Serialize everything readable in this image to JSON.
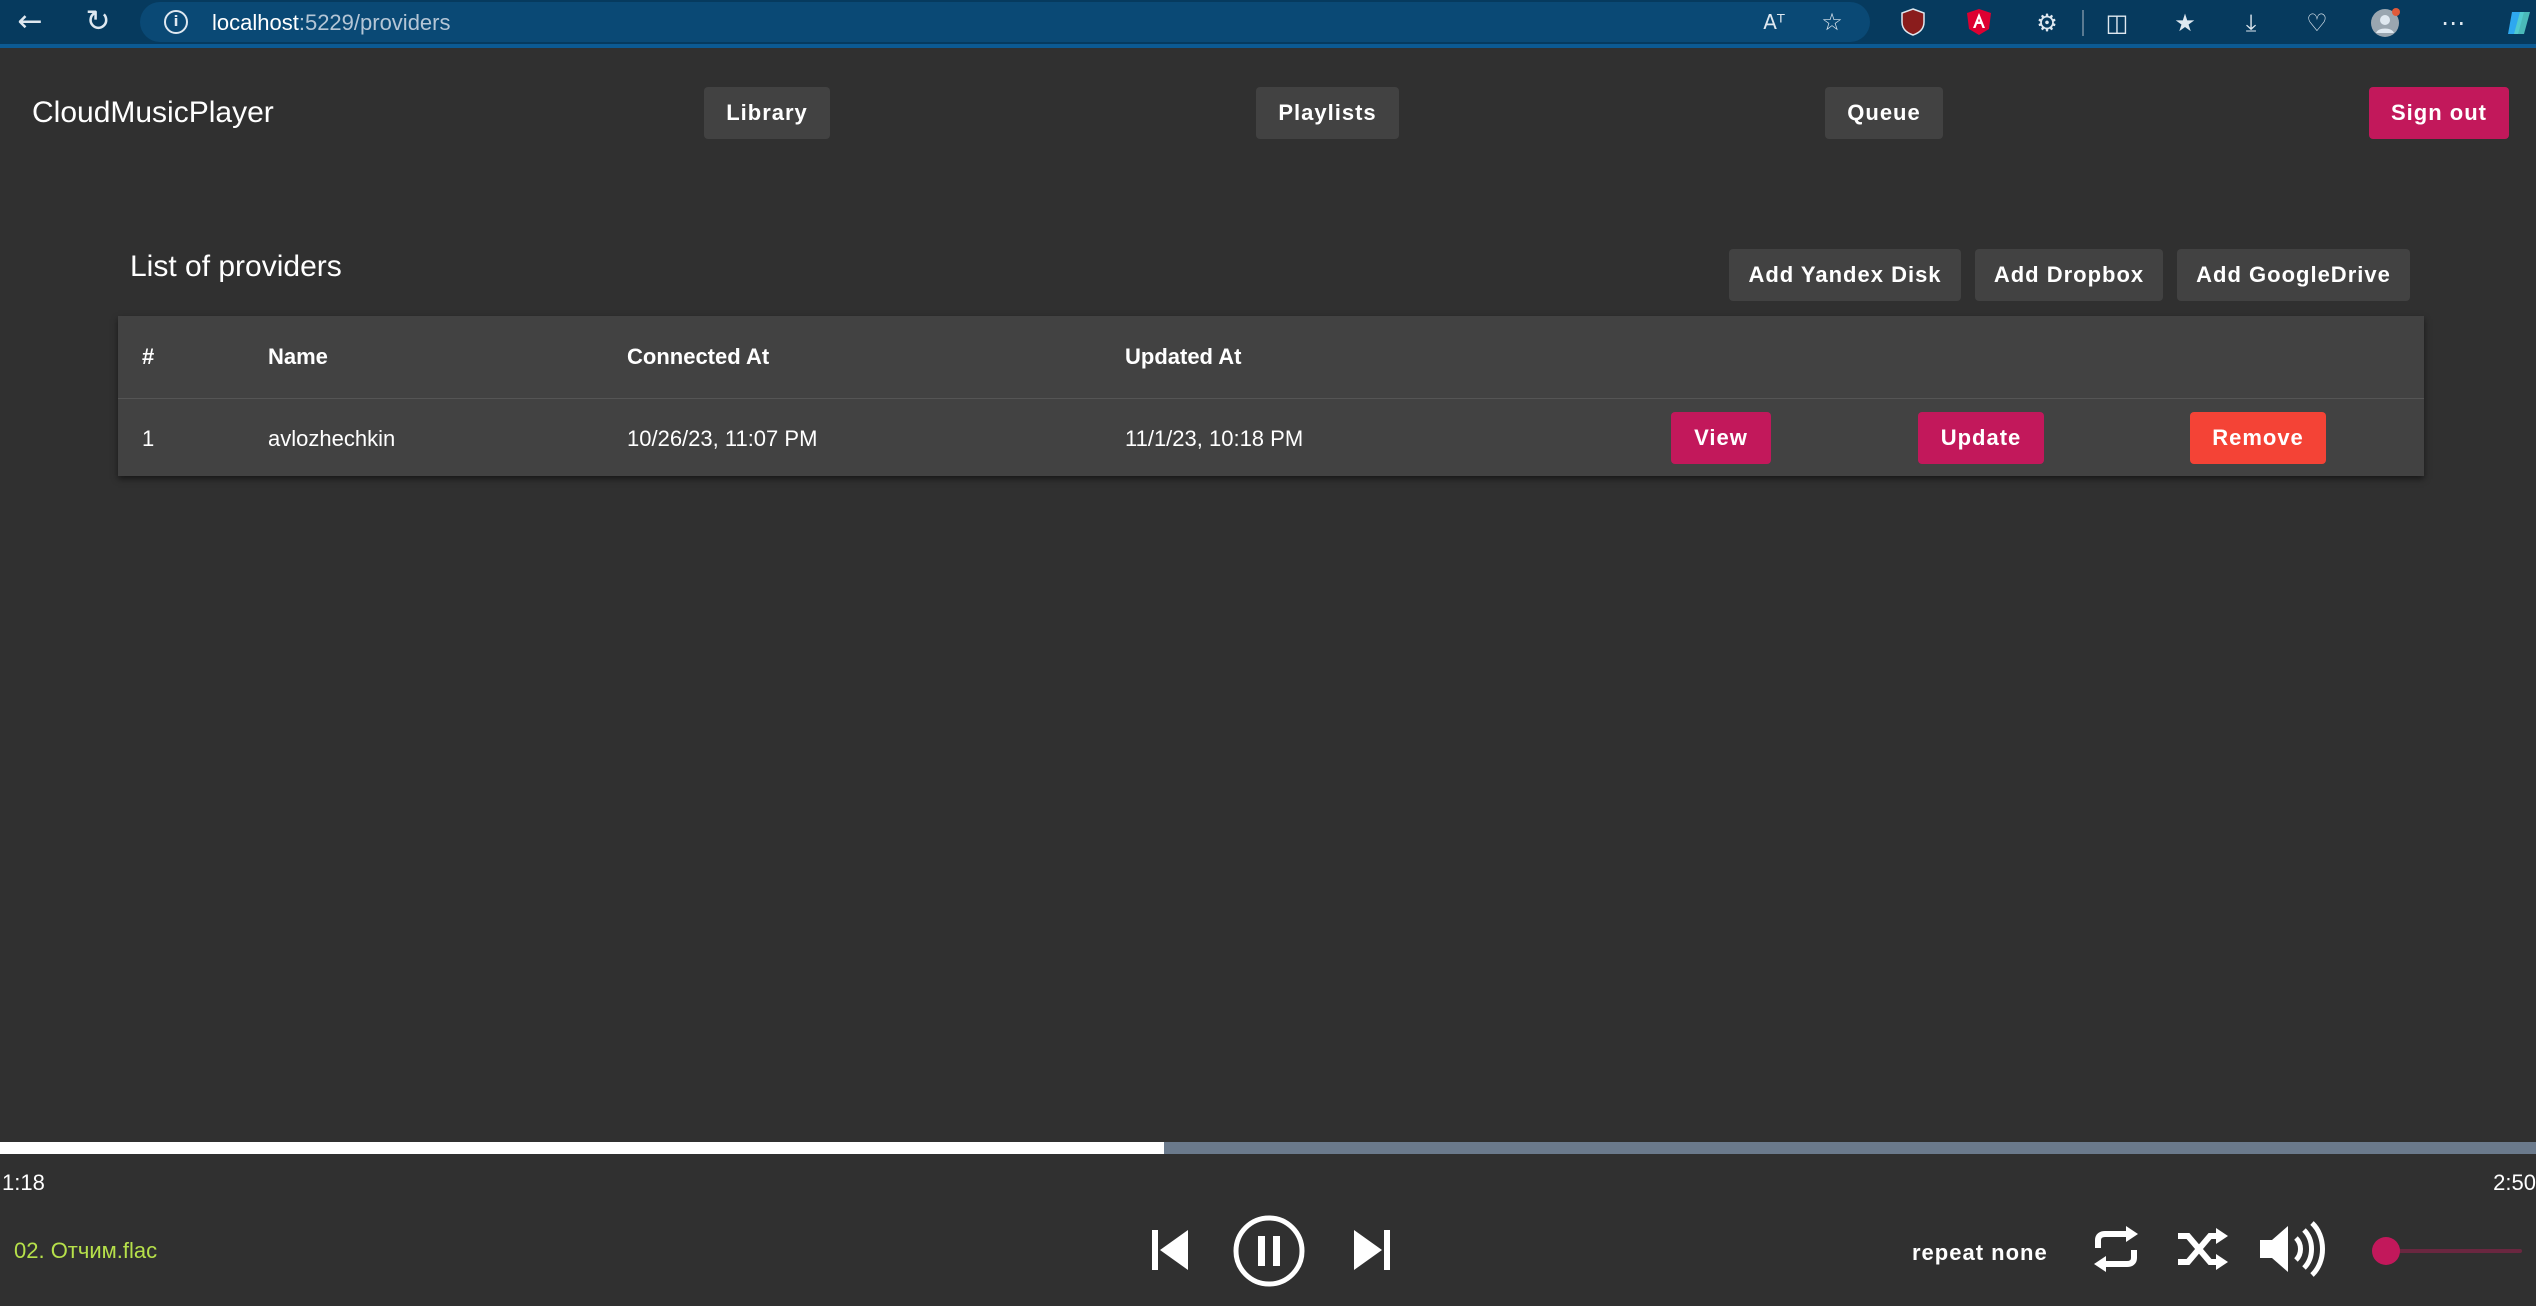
{
  "browser": {
    "url_host": "localhost",
    "url_path": ":5229/providers",
    "reader_icon_label": "Aᵀ"
  },
  "header": {
    "brand": "CloudMusicPlayer",
    "nav": {
      "library": "Library",
      "playlists": "Playlists",
      "queue": "Queue"
    },
    "sign_out": "Sign out"
  },
  "providers": {
    "title": "List of providers",
    "add_buttons": {
      "yandex": "Add Yandex Disk",
      "dropbox": "Add Dropbox",
      "google": "Add GoogleDrive"
    },
    "columns": {
      "index": "#",
      "name": "Name",
      "connected_at": "Connected At",
      "updated_at": "Updated At"
    },
    "rows": [
      {
        "index": "1",
        "name": "avlozhechkin",
        "connected_at": "10/26/23, 11:07 PM",
        "updated_at": "11/1/23, 10:18 PM",
        "view": "View",
        "update": "Update",
        "remove": "Remove"
      }
    ]
  },
  "player": {
    "elapsed": "1:18",
    "duration": "2:50",
    "progress_fraction": 0.4588,
    "track": "02. Отчим.flac",
    "repeat_mode": "repeat none",
    "volume_fraction": 0.0
  },
  "colors": {
    "background": "#303030",
    "surface": "#424242",
    "accent": "#c2185b",
    "warn": "#f44336",
    "track_text": "#b6e04a"
  }
}
